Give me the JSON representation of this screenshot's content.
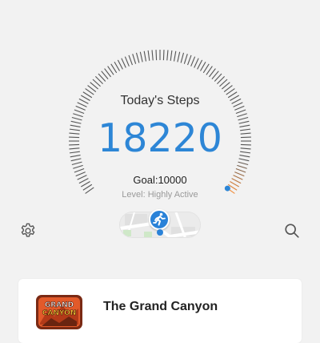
{
  "steps": {
    "title": "Today's Steps",
    "count": "18220",
    "goal": "Goal:10000",
    "level": "Level: Highly Active",
    "goal_fraction": 1.0
  },
  "icons": {
    "left": "settings-icon",
    "right": "search-icon",
    "center": "running-person-icon"
  },
  "card": {
    "title": "The Grand Canyon",
    "badge": "GRAND CANYON"
  },
  "colors": {
    "accent": "#2d86d6",
    "progress_end": "#f08c3a",
    "tick": "#555555",
    "background": "#f2f2f2"
  }
}
